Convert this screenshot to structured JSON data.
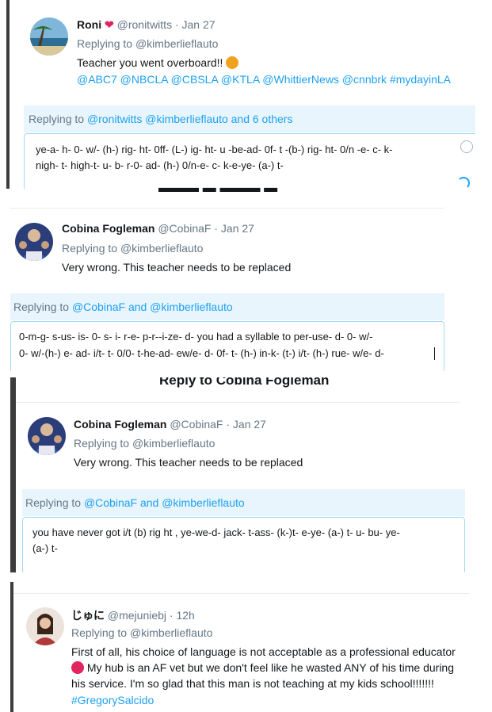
{
  "tweet1": {
    "name": "Roni",
    "handle": "@ronitwitts",
    "date": "· Jan 27",
    "replying_prefix": "Replying to",
    "replying_to": "@kimberlieflauto",
    "text": "Teacher you went overboard!!",
    "hashtags": "@ABC7  @NBCLA  @CBSLA @KTLA  @WhittierNews  @cnnbrk  #mydayinLA",
    "reply_prefix": "Replying to",
    "reply_users": "@ronitwitts @kimberlieflauto and 6 others",
    "compose_line1": "ye-a- h- 0- w/- (h-) rig- ht-  0ff- (L-)  ig- ht-  u -be-ad- 0f- t -(b-) rig- ht- 0/n -e- c- k-",
    "compose_line2": "nigh- t- high-t- u- b- r-0-  ad- (h-) 0/n-e- c- k-e-ye- (a-) t-"
  },
  "tweet2": {
    "name": "Cobina Fogleman",
    "handle": "@CobinaF",
    "date": "· Jan 27",
    "replying_prefix": "Replying to",
    "replying_to": "@kimberlieflauto",
    "text": "Very wrong.   This teacher needs to be replaced",
    "reply_prefix": "Replying to",
    "reply_users": "@CobinaF and @kimberlieflauto",
    "compose_line1": "0-m-g-  s-us- is- 0- s- i- r-e- p-r--i-ze- d-  you had a syllable to per-use- d-  0- w/-",
    "compose_line2": "0- w/-(h-) e- ad- i/t- t- 0/0- t-he-ad- ew/e- d- 0f- t- (h-) in-k- (t-) i/t- (h-) rue- w/e- d-"
  },
  "tweet3": {
    "heading": "Reply to Cobina Fogleman",
    "name": "Cobina Fogleman",
    "handle": "@CobinaF",
    "date": "· Jan 27",
    "replying_prefix": "Replying to",
    "replying_to": "@kimberlieflauto",
    "text": "Very wrong.   This teacher needs to be replaced",
    "reply_prefix": "Replying to",
    "reply_users": "@CobinaF and @kimberlieflauto",
    "compose_line1": "you have never got i/t (b) rig ht  , ye-we-d- jack- t-ass- (k-)t- e-ye- (a-) t- u- bu- ye-",
    "compose_line2": "(a-) t-"
  },
  "tweet4": {
    "name": "じゅに",
    "handle": "@mejuniebj",
    "date": "· 12h",
    "replying_prefix": "Replying to",
    "replying_to": "@kimberlieflauto",
    "line1": "First of all, his choice of language is not acceptable as a professional educator",
    "line2": "My hub is an AF vet but we don't feel like he wasted ANY of his time during",
    "line3": "his service. I'm so glad that this man is not teaching at my kids school!!!!!!!",
    "hashtag": "#GregorySalcido"
  },
  "colors": {
    "link": "#1da1f2",
    "muted": "#657786",
    "reply_bg": "#e8f5fd",
    "heart": "#e0245e",
    "angry_emoji": "#f2a11e",
    "red_emoji": "#e0245e"
  }
}
